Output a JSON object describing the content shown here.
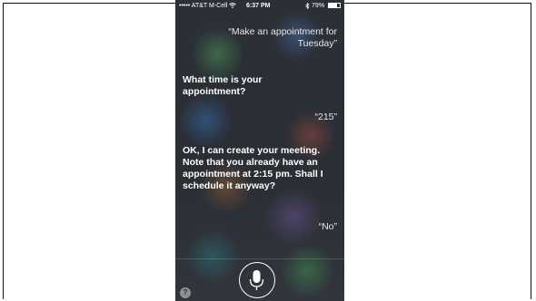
{
  "status_bar": {
    "carrier": "••••• AT&T M-Cell",
    "time": "6:37 PM",
    "battery_text": "79%",
    "battery_level": 0.79
  },
  "conversation": {
    "user_1": "“Make an appointment for Tuesday”",
    "siri_1": "What time is your appointment?",
    "user_2": "“215”",
    "siri_2": "OK, I can create your meeting. Note that you already have an appointment at 2:15 pm. Shall I schedule it anyway?",
    "user_3": "“No”"
  },
  "controls": {
    "help_glyph": "?"
  },
  "icons": [
    "wifi-icon",
    "bluetooth-icon",
    "battery-icon",
    "microphone-icon",
    "help-icon"
  ]
}
